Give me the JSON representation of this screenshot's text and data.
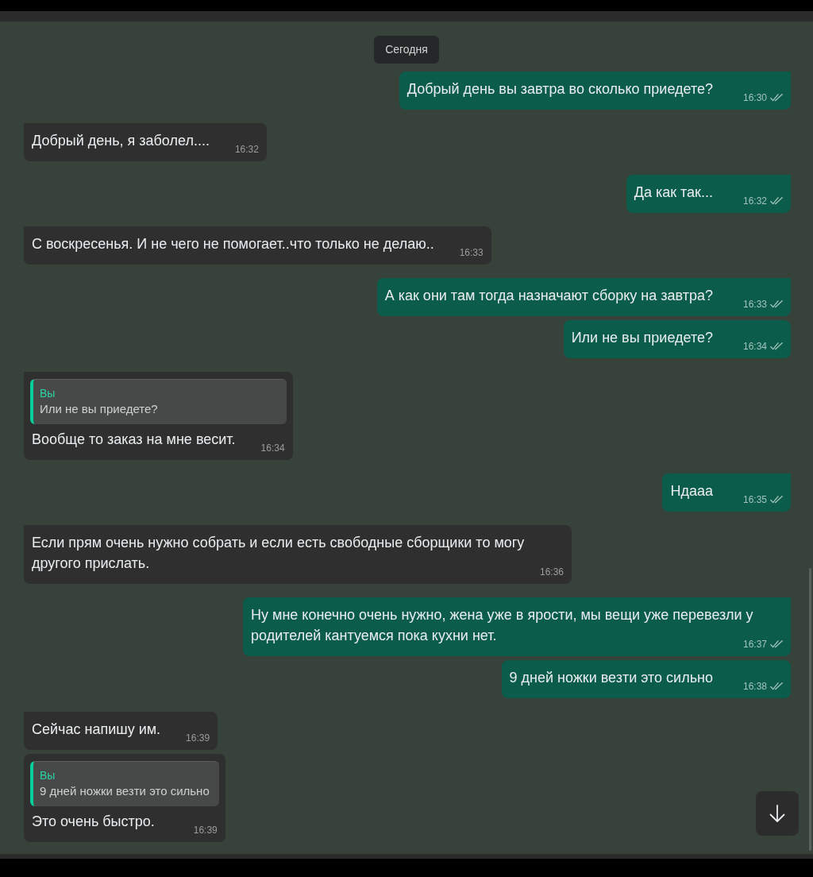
{
  "date_chip": "Сегодня",
  "messages": [
    {
      "kind": "outgoing",
      "text": "Добрый день вы завтра во сколько приедете?",
      "time": "16:30",
      "read": false
    },
    {
      "kind": "incoming",
      "text": "Добрый день, я заболел....",
      "time": "16:32"
    },
    {
      "kind": "outgoing",
      "text": "Да как так...",
      "time": "16:32",
      "read": false
    },
    {
      "kind": "incoming",
      "text": "С воскресенья. И не чего не помогает..что только не делаю..",
      "time": "16:33"
    },
    {
      "kind": "outgoing",
      "text": "А как они там тогда назначают сборку на завтра?",
      "time": "16:33",
      "read": false
    },
    {
      "kind": "outgoing",
      "text": "Или не вы приедете?",
      "time": "16:34",
      "read": false
    },
    {
      "kind": "incoming",
      "quote": {
        "author": "Вы",
        "text": "Или не вы приедете?"
      },
      "text": "Вообще то заказ на мне весит.",
      "time": "16:34"
    },
    {
      "kind": "outgoing",
      "text": "Ндааа",
      "time": "16:35",
      "read": false
    },
    {
      "kind": "incoming",
      "text": "Если прям очень нужно собрать и если есть свободные сборщики то могу другого прислать.",
      "time": "16:36"
    },
    {
      "kind": "outgoing",
      "text": "Ну мне конечно очень нужно, жена уже в ярости, мы вещи уже перевезли у родителей кантуемся пока кухни нет.",
      "time": "16:37",
      "read": false
    },
    {
      "kind": "outgoing",
      "text": "9 дней ножки везти это сильно",
      "time": "16:38",
      "read": false
    },
    {
      "kind": "incoming",
      "text": "Сейчас напишу им.",
      "time": "16:39"
    },
    {
      "kind": "incoming",
      "quote": {
        "author": "Вы",
        "text": "9 дней ножки везти это сильно"
      },
      "text": "Это очень быстро.",
      "time": "16:39"
    }
  ]
}
